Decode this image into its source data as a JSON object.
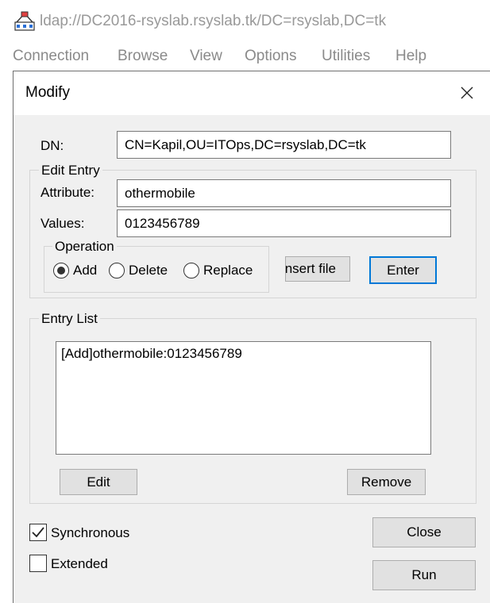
{
  "app": {
    "title": "ldap://DC2016-rsyslab.rsyslab.tk/DC=rsyslab,DC=tk",
    "icon": "ldp-network-icon",
    "menu": [
      "Connection",
      "Browse",
      "View",
      "Options",
      "Utilities",
      "Help"
    ]
  },
  "dialog": {
    "title": "Modify",
    "close_icon": "close-icon",
    "dn_label": "DN:",
    "dn_value": "CN=Kapil,OU=ITOps,DC=rsyslab,DC=tk",
    "edit_entry": {
      "title": "Edit Entry",
      "attribute_label": "Attribute:",
      "attribute_value": "othermobile",
      "values_label": "Values:",
      "values_value": "0123456789",
      "operation": {
        "title": "Operation",
        "options": [
          "Add",
          "Delete",
          "Replace"
        ],
        "selected": "Add"
      },
      "insert_file_label": "Insert file",
      "enter_label": "Enter"
    },
    "entry_list": {
      "title": "Entry List",
      "items": [
        "[Add]othermobile:0123456789"
      ],
      "edit_label": "Edit",
      "remove_label": "Remove"
    },
    "synchronous": {
      "label": "Synchronous",
      "checked": true
    },
    "extended": {
      "label": "Extended",
      "checked": false
    },
    "close_label": "Close",
    "run_label": "Run"
  },
  "colors": {
    "dialog_bg": "#f0f0f0",
    "default_button_border": "#0078d7",
    "menu_text": "#8a8a8a"
  }
}
